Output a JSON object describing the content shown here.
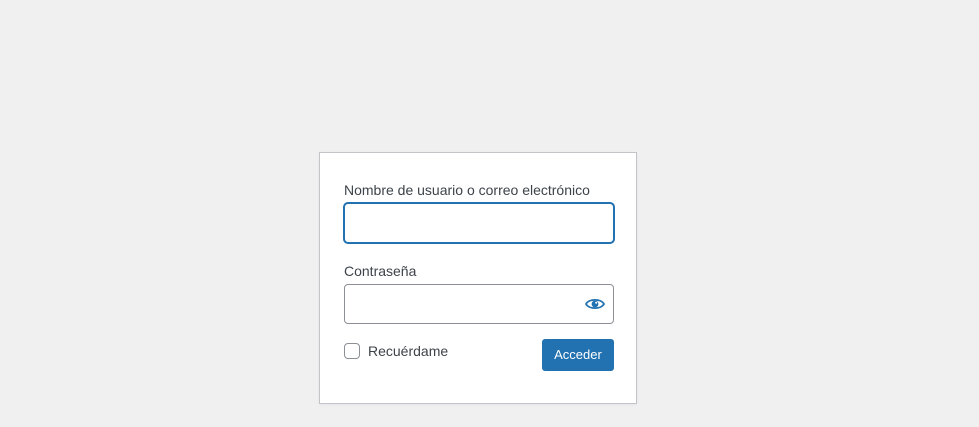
{
  "login": {
    "username_label": "Nombre de usuario o correo electrónico",
    "username_value": "",
    "password_label": "Contraseña",
    "password_value": "",
    "show_password_icon": "eye-icon",
    "remember_label": "Recuérdame",
    "remember_checked": false,
    "submit_label": "Acceder"
  },
  "colors": {
    "page_background": "#f0f0f1",
    "form_background": "#ffffff",
    "accent": "#2271b1",
    "text": "#3c434a",
    "input_border": "#8c8f94"
  }
}
